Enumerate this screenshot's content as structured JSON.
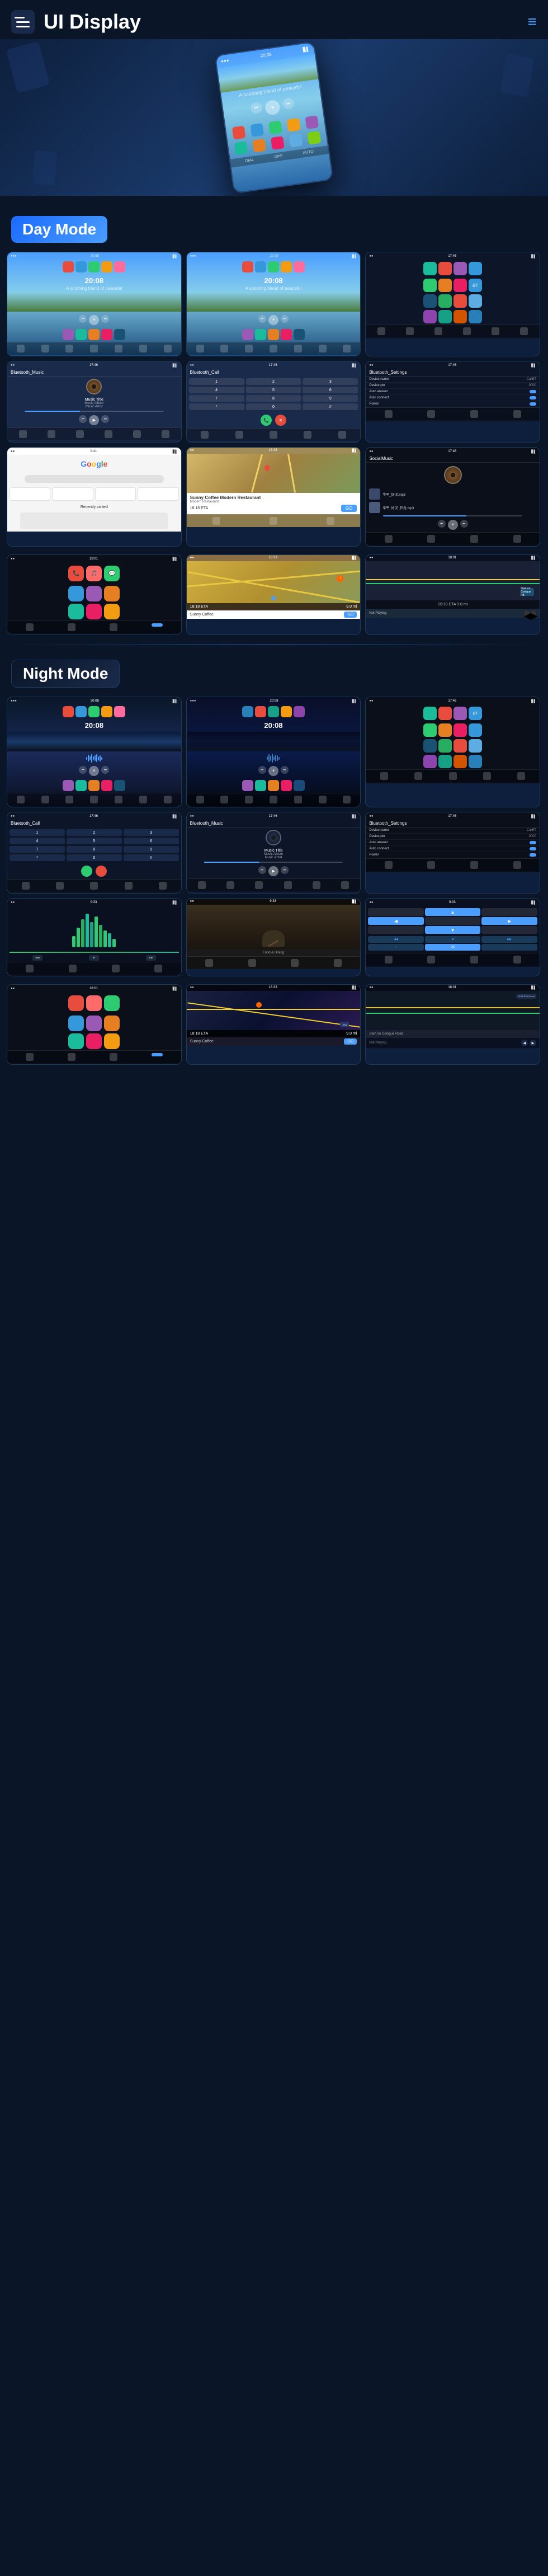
{
  "header": {
    "title": "UI Display",
    "menu_icon": "menu-icon",
    "nav_icon": "≡"
  },
  "hero": {
    "time": "20:08",
    "subtitle": "A soothing blend of peaceful"
  },
  "day_mode": {
    "label": "Day Mode",
    "screens": [
      {
        "id": "day-home-1",
        "type": "home",
        "time": "20:08",
        "subtitle": "A soothing blend of peaceful"
      },
      {
        "id": "day-home-2",
        "type": "home",
        "time": "20:08",
        "subtitle": "A soothing blend of peaceful"
      },
      {
        "id": "day-apps",
        "type": "apps"
      },
      {
        "id": "day-music",
        "type": "music",
        "title": "Bluetooth_Music",
        "music_title": "Music Title",
        "music_album": "Music Album",
        "music_artist": "Music Artist"
      },
      {
        "id": "day-phone",
        "type": "phone",
        "title": "Bluetooth_Call"
      },
      {
        "id": "day-settings",
        "type": "settings",
        "title": "Bluetooth_Settings",
        "device_name": "CarBT",
        "device_pin": "0000"
      },
      {
        "id": "day-carplay",
        "type": "carplay"
      },
      {
        "id": "day-waze",
        "type": "waze",
        "place": "Sunny Coffee Modern Restaurant",
        "eta": "18:18 ETA",
        "distance": "9.0 mi"
      },
      {
        "id": "day-social",
        "type": "social",
        "title": "SocialMusic"
      }
    ]
  },
  "night_mode": {
    "label": "Night Mode",
    "screens": [
      {
        "id": "night-home-1",
        "type": "home-dark",
        "time": "20:08"
      },
      {
        "id": "night-home-2",
        "type": "home-dark",
        "time": "20:08"
      },
      {
        "id": "night-apps",
        "type": "apps-dark"
      },
      {
        "id": "night-phone",
        "type": "phone-dark",
        "title": "Bluetooth_Call"
      },
      {
        "id": "night-music",
        "type": "music-dark",
        "title": "Bluetooth_Music",
        "music_title": "Music Title",
        "music_album": "Music Album",
        "music_artist": "Music Artist"
      },
      {
        "id": "night-settings",
        "type": "settings-dark",
        "title": "Bluetooth_Settings"
      },
      {
        "id": "night-eq",
        "type": "equalizer"
      },
      {
        "id": "night-food",
        "type": "food"
      },
      {
        "id": "night-nav",
        "type": "navigation"
      },
      {
        "id": "night-carplay",
        "type": "carplay-dark"
      },
      {
        "id": "night-waze",
        "type": "waze-dark",
        "place": "Sunny Coffee Modern Restaurant",
        "eta": "18:18 ETA"
      },
      {
        "id": "night-road",
        "type": "road-dark",
        "road": "Start on Conigue Road",
        "status": "Not Playing"
      }
    ]
  },
  "music_text": {
    "title": "Music Title",
    "album": "Music Album",
    "artist": "Music Artist"
  }
}
